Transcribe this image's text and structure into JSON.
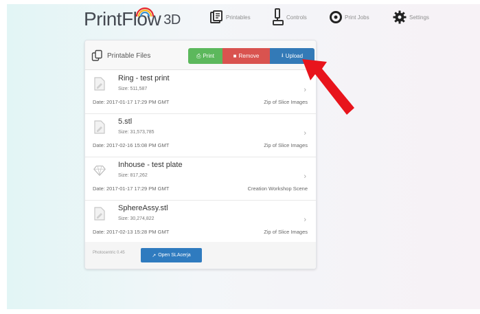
{
  "app": {
    "logo_main": "PrintFl",
    "logo_o": "o",
    "logo_w": "w",
    "logo_suffix": "3D"
  },
  "nav": [
    {
      "label": "Printables",
      "icon": "printables-icon"
    },
    {
      "label": "Controls",
      "icon": "controls-icon"
    },
    {
      "label": "Print Jobs",
      "icon": "print-jobs-icon"
    },
    {
      "label": "Settings",
      "icon": "settings-gear-icon"
    }
  ],
  "panel": {
    "title": "Printable Files",
    "buttons": {
      "print": "Print",
      "remove": "Remove",
      "upload": "Upload"
    }
  },
  "files": [
    {
      "name": "Ring - test print",
      "size": "Size: 511,587",
      "date": "Date: 2017-01-17 17:29 PM GMT",
      "type": "Zip of Slice Images",
      "icon": "file-icon"
    },
    {
      "name": "5.stl",
      "size": "Size: 31,573,785",
      "date": "Date: 2017-02-16 15:08 PM GMT",
      "type": "Zip of Slice Images",
      "icon": "file-icon"
    },
    {
      "name": "Inhouse - test plate",
      "size": "Size: 817,262",
      "date": "Date: 2017-01-17 17:29 PM GMT",
      "type": "Creation Workshop Scene",
      "icon": "gem-icon"
    },
    {
      "name": "SphereAssy.stl",
      "size": "Size: 30,274,822",
      "date": "Date: 2017-02-13 15:28 PM GMT",
      "type": "Zip of Slice Images",
      "icon": "file-icon"
    }
  ],
  "footer": {
    "version": "Photocentric 0.45",
    "open_button": "Open SLAcerja"
  },
  "colors": {
    "print": "#5cb85c",
    "remove": "#d9534f",
    "upload": "#337ab7",
    "annotation_arrow": "#e8141c"
  }
}
